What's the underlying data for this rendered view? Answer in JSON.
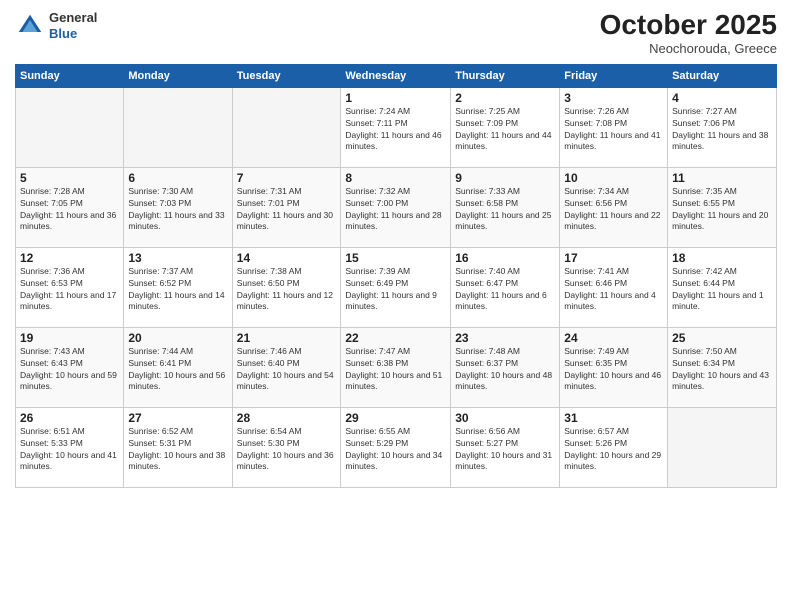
{
  "logo": {
    "general": "General",
    "blue": "Blue"
  },
  "header": {
    "month": "October 2025",
    "location": "Neochorouda, Greece"
  },
  "weekdays": [
    "Sunday",
    "Monday",
    "Tuesday",
    "Wednesday",
    "Thursday",
    "Friday",
    "Saturday"
  ],
  "weeks": [
    [
      {
        "day": "",
        "empty": true
      },
      {
        "day": "",
        "empty": true
      },
      {
        "day": "",
        "empty": true
      },
      {
        "day": "1",
        "sunrise": "7:24 AM",
        "sunset": "7:11 PM",
        "daylight": "11 hours and 46 minutes."
      },
      {
        "day": "2",
        "sunrise": "7:25 AM",
        "sunset": "7:09 PM",
        "daylight": "11 hours and 44 minutes."
      },
      {
        "day": "3",
        "sunrise": "7:26 AM",
        "sunset": "7:08 PM",
        "daylight": "11 hours and 41 minutes."
      },
      {
        "day": "4",
        "sunrise": "7:27 AM",
        "sunset": "7:06 PM",
        "daylight": "11 hours and 38 minutes."
      }
    ],
    [
      {
        "day": "5",
        "sunrise": "7:28 AM",
        "sunset": "7:05 PM",
        "daylight": "11 hours and 36 minutes."
      },
      {
        "day": "6",
        "sunrise": "7:30 AM",
        "sunset": "7:03 PM",
        "daylight": "11 hours and 33 minutes."
      },
      {
        "day": "7",
        "sunrise": "7:31 AM",
        "sunset": "7:01 PM",
        "daylight": "11 hours and 30 minutes."
      },
      {
        "day": "8",
        "sunrise": "7:32 AM",
        "sunset": "7:00 PM",
        "daylight": "11 hours and 28 minutes."
      },
      {
        "day": "9",
        "sunrise": "7:33 AM",
        "sunset": "6:58 PM",
        "daylight": "11 hours and 25 minutes."
      },
      {
        "day": "10",
        "sunrise": "7:34 AM",
        "sunset": "6:56 PM",
        "daylight": "11 hours and 22 minutes."
      },
      {
        "day": "11",
        "sunrise": "7:35 AM",
        "sunset": "6:55 PM",
        "daylight": "11 hours and 20 minutes."
      }
    ],
    [
      {
        "day": "12",
        "sunrise": "7:36 AM",
        "sunset": "6:53 PM",
        "daylight": "11 hours and 17 minutes."
      },
      {
        "day": "13",
        "sunrise": "7:37 AM",
        "sunset": "6:52 PM",
        "daylight": "11 hours and 14 minutes."
      },
      {
        "day": "14",
        "sunrise": "7:38 AM",
        "sunset": "6:50 PM",
        "daylight": "11 hours and 12 minutes."
      },
      {
        "day": "15",
        "sunrise": "7:39 AM",
        "sunset": "6:49 PM",
        "daylight": "11 hours and 9 minutes."
      },
      {
        "day": "16",
        "sunrise": "7:40 AM",
        "sunset": "6:47 PM",
        "daylight": "11 hours and 6 minutes."
      },
      {
        "day": "17",
        "sunrise": "7:41 AM",
        "sunset": "6:46 PM",
        "daylight": "11 hours and 4 minutes."
      },
      {
        "day": "18",
        "sunrise": "7:42 AM",
        "sunset": "6:44 PM",
        "daylight": "11 hours and 1 minute."
      }
    ],
    [
      {
        "day": "19",
        "sunrise": "7:43 AM",
        "sunset": "6:43 PM",
        "daylight": "10 hours and 59 minutes."
      },
      {
        "day": "20",
        "sunrise": "7:44 AM",
        "sunset": "6:41 PM",
        "daylight": "10 hours and 56 minutes."
      },
      {
        "day": "21",
        "sunrise": "7:46 AM",
        "sunset": "6:40 PM",
        "daylight": "10 hours and 54 minutes."
      },
      {
        "day": "22",
        "sunrise": "7:47 AM",
        "sunset": "6:38 PM",
        "daylight": "10 hours and 51 minutes."
      },
      {
        "day": "23",
        "sunrise": "7:48 AM",
        "sunset": "6:37 PM",
        "daylight": "10 hours and 48 minutes."
      },
      {
        "day": "24",
        "sunrise": "7:49 AM",
        "sunset": "6:35 PM",
        "daylight": "10 hours and 46 minutes."
      },
      {
        "day": "25",
        "sunrise": "7:50 AM",
        "sunset": "6:34 PM",
        "daylight": "10 hours and 43 minutes."
      }
    ],
    [
      {
        "day": "26",
        "sunrise": "6:51 AM",
        "sunset": "5:33 PM",
        "daylight": "10 hours and 41 minutes."
      },
      {
        "day": "27",
        "sunrise": "6:52 AM",
        "sunset": "5:31 PM",
        "daylight": "10 hours and 38 minutes."
      },
      {
        "day": "28",
        "sunrise": "6:54 AM",
        "sunset": "5:30 PM",
        "daylight": "10 hours and 36 minutes."
      },
      {
        "day": "29",
        "sunrise": "6:55 AM",
        "sunset": "5:29 PM",
        "daylight": "10 hours and 34 minutes."
      },
      {
        "day": "30",
        "sunrise": "6:56 AM",
        "sunset": "5:27 PM",
        "daylight": "10 hours and 31 minutes."
      },
      {
        "day": "31",
        "sunrise": "6:57 AM",
        "sunset": "5:26 PM",
        "daylight": "10 hours and 29 minutes."
      },
      {
        "day": "",
        "empty": true
      }
    ]
  ]
}
